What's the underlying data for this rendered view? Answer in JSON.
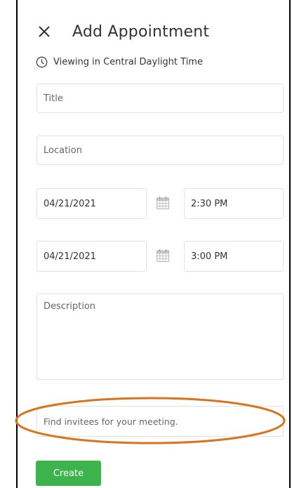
{
  "header": {
    "title": "Add Appointment",
    "close_icon": "close-icon"
  },
  "timezone": {
    "icon": "clock-icon",
    "text": "Viewing in Central Daylight Time"
  },
  "form": {
    "title_placeholder": "Title",
    "location_placeholder": "Location",
    "start_date": "04/21/2021",
    "start_time": "2:30 PM",
    "end_date": "04/21/2021",
    "end_time": "3:00 PM",
    "calendar_icon": "calendar-icon",
    "description_placeholder": "Description",
    "invitees_placeholder": "Find invitees for your meeting."
  },
  "actions": {
    "create_label": "Create"
  },
  "colors": {
    "primary": "#3cb44b",
    "highlight": "#d9731d",
    "border": "#e2e2e2",
    "text": "#333333"
  }
}
